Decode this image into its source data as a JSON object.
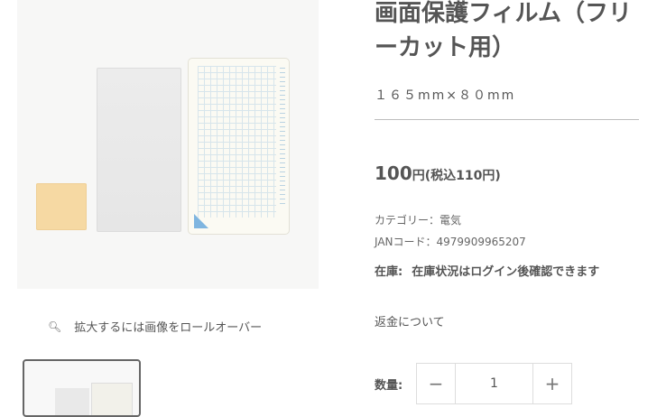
{
  "product": {
    "title": "画面保護フィルム（フリーカット用）",
    "size_label": "１６５mm×８０mm",
    "price_main": "100",
    "price_yen": "円",
    "price_tax": "(税込110円)",
    "category": "カテゴリー：電気",
    "jan": "JANコード：4979909965207",
    "stock_label": "在庫:",
    "stock_value": "在庫状況はログイン後確認できます",
    "return_link": "返金について",
    "quantity_label": "数量:",
    "quantity_value": "1"
  },
  "gallery": {
    "zoom_hint": "拡大するには画像をロールオーバー"
  },
  "icons": {
    "zoom": "search-icon",
    "minus": "minus-icon",
    "plus": "plus-icon"
  },
  "colors": {
    "text": "#555555",
    "divider": "#bdbdbd",
    "cloth": "#f6d9a3"
  }
}
